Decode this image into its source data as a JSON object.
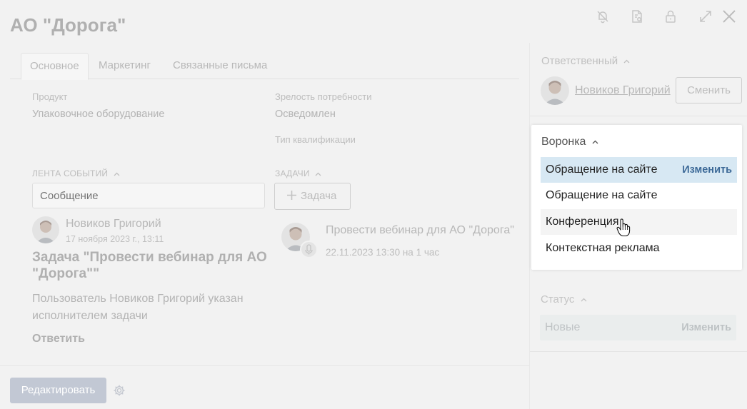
{
  "header": {
    "title": "АО \"Дорога\"",
    "icons": [
      "bell-off-icon",
      "document-settings-icon",
      "lock-icon",
      "expand-icon",
      "close-icon"
    ]
  },
  "tabs": [
    {
      "label": "Основное",
      "active": true
    },
    {
      "label": "Маркетинг",
      "active": false
    },
    {
      "label": "Связанные письма",
      "active": false
    }
  ],
  "fields": {
    "product_label": "Продукт",
    "product_value": "Упаковочное оборудование",
    "maturity_label": "Зрелость потребности",
    "maturity_value": "Осведомлен",
    "qualification_label": "Тип квалификации"
  },
  "feed": {
    "section_label": "ЛЕНТА СОБЫТИЙ",
    "message_placeholder": "Сообщение",
    "author": "Новиков Григорий",
    "date": "17 ноября 2023 г., 13:11",
    "headline": "Задача \"Провести вебинар для АО \"Дорога\"\"",
    "text": "Пользователь Новиков Григорий указан исполнителем задачи",
    "reply_label": "Ответить"
  },
  "tasks": {
    "section_label": "ЗАДАЧИ",
    "add_button_label": "Задача",
    "task_title": "Провести вебинар для АО \"Дорога\"",
    "task_time": "22.11.2023 13:30 на 1 час"
  },
  "footer": {
    "edit_label": "Редактировать"
  },
  "sidebar": {
    "responsible_label": "Ответственный",
    "responsible_name": "Новиков Григорий",
    "change_label": "Сменить",
    "status_label": "Статус",
    "status_value": "Новые",
    "status_change_label": "Изменить"
  },
  "funnel_popup": {
    "title": "Воронка",
    "current": "Обращение на сайте",
    "change_label": "Изменить",
    "options": [
      "Обращение на сайте",
      "Конференция",
      "Контекстная реклама"
    ],
    "hovered_option": "Конференция"
  },
  "colors": {
    "accent_link": "#3d6a98",
    "selected_row": "#d7e8f3",
    "edit_button": "#c2c8d4"
  }
}
